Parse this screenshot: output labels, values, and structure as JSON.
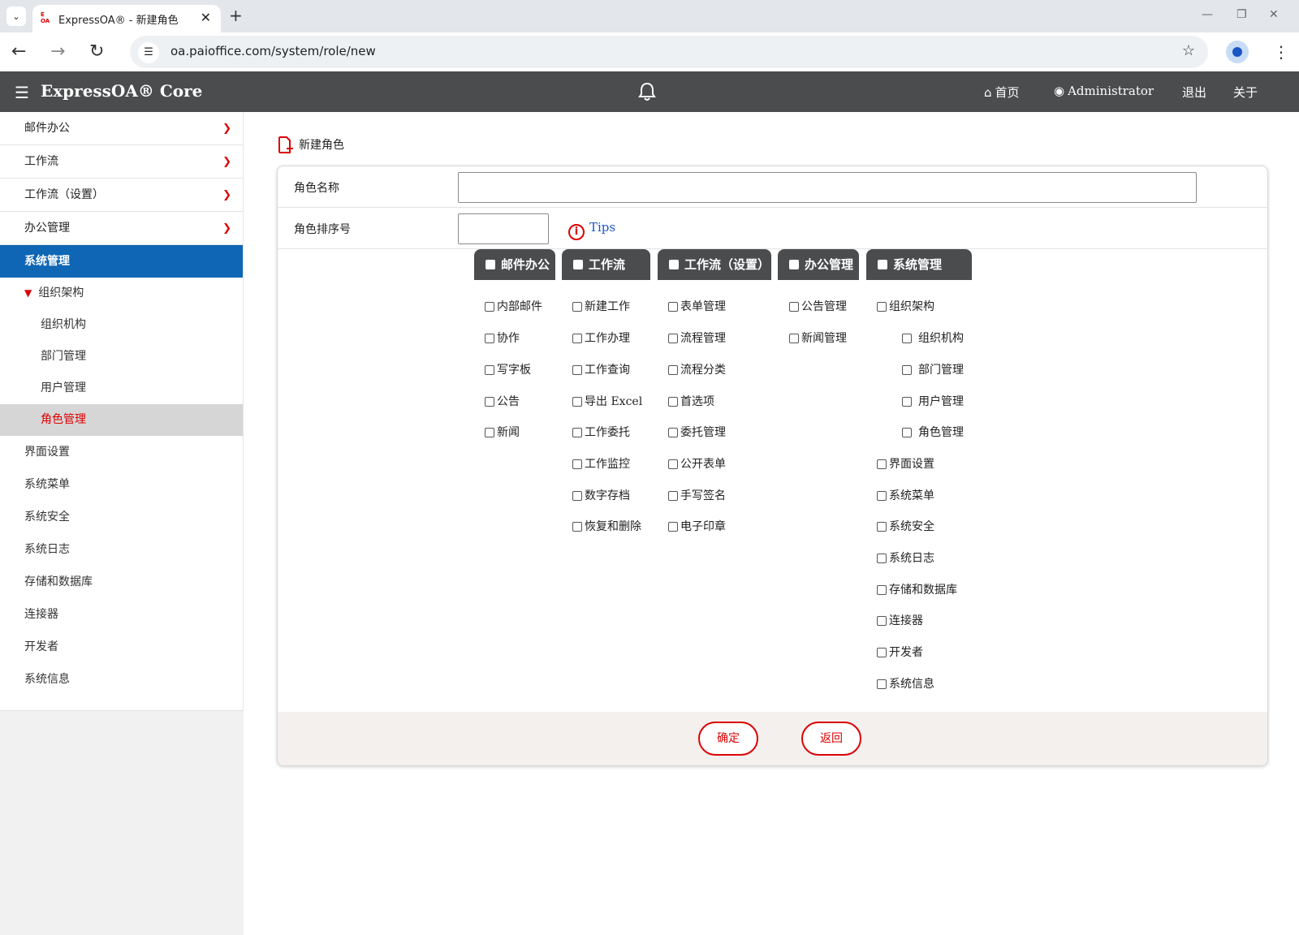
{
  "browser": {
    "tab_title": "ExpressOA® - 新建角色",
    "favicon_top": "E",
    "favicon_bottom": "OA",
    "url": "oa.paioffice.com/system/role/new",
    "new_tab": "+",
    "tab_close": "✕"
  },
  "header": {
    "brand": "ExpressOA® Core",
    "home": "首页",
    "user": "Administrator",
    "logout": "退出",
    "about": "关于"
  },
  "sidebar": {
    "sections": [
      "邮件办公",
      "工作流",
      "工作流（设置）",
      "办公管理"
    ],
    "active": "系统管理",
    "group": "组织架构",
    "group_items": [
      "组织机构",
      "部门管理",
      "用户管理",
      "角色管理"
    ],
    "selected": "角色管理",
    "plain_items": [
      "界面设置",
      "系统菜单",
      "系统安全",
      "系统日志",
      "存储和数据库",
      "连接器",
      "开发者",
      "系统信息"
    ]
  },
  "page": {
    "title": "新建角色",
    "role_name_label": "角色名称",
    "role_name_value": "",
    "order_label": "角色排序号",
    "order_value": "",
    "tips": "Tips",
    "confirm": "确定",
    "back": "返回"
  },
  "modules": [
    {
      "name": "邮件办公",
      "items": [
        "内部邮件",
        "协作",
        "写字板",
        "公告",
        "新闻"
      ]
    },
    {
      "name": "工作流",
      "items": [
        "新建工作",
        "工作办理",
        "工作查询",
        "导出 Excel",
        "工作委托",
        "工作监控",
        "数字存档",
        "恢复和删除"
      ]
    },
    {
      "name": "工作流（设置）",
      "items": [
        "表单管理",
        "流程管理",
        "流程分类",
        "首选项",
        "委托管理",
        "公开表单",
        "手写签名",
        "电子印章"
      ]
    },
    {
      "name": "办公管理",
      "items": [
        "公告管理",
        "新闻管理"
      ]
    },
    {
      "name": "系统管理",
      "items": [
        "组织架构",
        "组织机构",
        "部门管理",
        "用户管理",
        "角色管理",
        "界面设置",
        "系统菜单",
        "系统安全",
        "系统日志",
        "存储和数据库",
        "连接器",
        "开发者",
        "系统信息"
      ]
    }
  ]
}
